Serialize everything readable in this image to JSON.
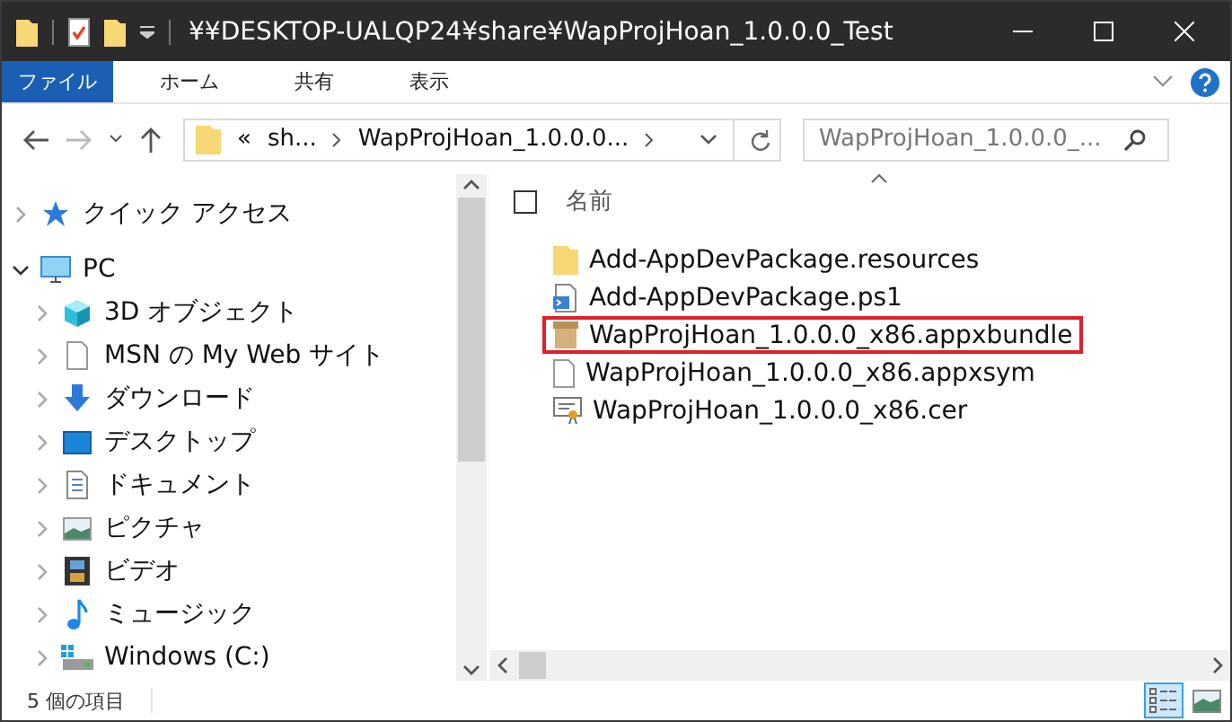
{
  "window": {
    "title": "¥¥DESKTOP-UALQP24¥share¥WapProjHoan_1.0.0.0_Test"
  },
  "ribbon_tabs": [
    {
      "label": "ファイル",
      "selected": true
    },
    {
      "label": "ホーム",
      "selected": false
    },
    {
      "label": "共有",
      "selected": false
    },
    {
      "label": "表示",
      "selected": false
    }
  ],
  "address": {
    "crumbs": [
      "«",
      "sh...",
      "WapProjHoan_1.0.0.0..."
    ]
  },
  "search": {
    "placeholder": "WapProjHoan_1.0.0.0_..."
  },
  "nav": [
    {
      "label": "クイック アクセス",
      "kind": "star",
      "expanded": false
    },
    {
      "label": "PC",
      "kind": "pc",
      "expanded": true,
      "children": [
        {
          "label": "3D オブジェクト",
          "kind": "cube",
          "expanded": false
        },
        {
          "label": "MSN の My Web サイト",
          "kind": "page",
          "expanded": false
        },
        {
          "label": "ダウンロード",
          "kind": "download",
          "expanded": false
        },
        {
          "label": "デスクトップ",
          "kind": "desktop",
          "expanded": false
        },
        {
          "label": "ドキュメント",
          "kind": "document",
          "expanded": false
        },
        {
          "label": "ピクチャ",
          "kind": "picture",
          "expanded": false
        },
        {
          "label": "ビデオ",
          "kind": "film",
          "expanded": false
        },
        {
          "label": "ミュージック",
          "kind": "music",
          "expanded": false
        },
        {
          "label": "Windows (C:)",
          "kind": "drive",
          "expanded": false
        }
      ]
    }
  ],
  "select_all": {
    "checked": false
  },
  "columns": [
    {
      "label": "名前"
    }
  ],
  "files": [
    {
      "name": "Add-AppDevPackage.resources",
      "kind": "folder",
      "highlighted": false
    },
    {
      "name": "Add-AppDevPackage.ps1",
      "kind": "script",
      "highlighted": false
    },
    {
      "name": "WapProjHoan_1.0.0.0_x86.appxbundle",
      "kind": "package",
      "highlighted": true
    },
    {
      "name": "WapProjHoan_1.0.0.0_x86.appxsym",
      "kind": "file",
      "highlighted": false
    },
    {
      "name": "WapProjHoan_1.0.0.0_x86.cer",
      "kind": "certificate",
      "highlighted": false
    }
  ],
  "status_bar": {
    "count": "5 個の項目"
  },
  "view_buttons": [
    {
      "kind": "details",
      "selected": true
    },
    {
      "kind": "tiles",
      "selected": false
    }
  ]
}
